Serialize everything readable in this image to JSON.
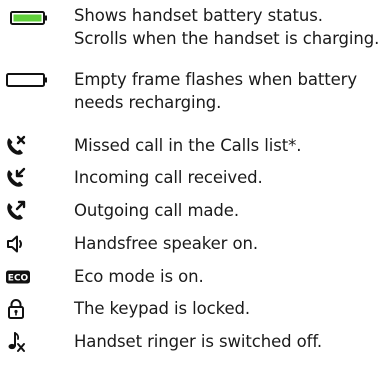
{
  "legend": {
    "colors": {
      "battery_fill": "#5fcf3a",
      "icon_dark": "#111111",
      "text": "#1a1a1a"
    },
    "items": [
      {
        "icon": "battery-charging-icon",
        "lines": [
          "Shows handset battery status.",
          "Scrolls when the handset is charging."
        ]
      },
      {
        "icon": "battery-empty-icon",
        "lines": [
          "Empty frame flashes when battery",
          "needs recharging."
        ]
      },
      {
        "icon": "missed-call-icon",
        "lines": [
          "Missed call in the Calls list*."
        ]
      },
      {
        "icon": "incoming-call-icon",
        "lines": [
          "Incoming call received."
        ]
      },
      {
        "icon": "outgoing-call-icon",
        "lines": [
          "Outgoing call made."
        ]
      },
      {
        "icon": "speaker-icon",
        "lines": [
          "Handsfree speaker on."
        ]
      },
      {
        "icon": "eco-mode-icon",
        "badge": "ECO",
        "lines": [
          "Eco mode is on."
        ]
      },
      {
        "icon": "keypad-lock-icon",
        "lines": [
          "The keypad is locked."
        ]
      },
      {
        "icon": "ringer-off-icon",
        "lines": [
          "Handset ringer is switched off."
        ]
      }
    ]
  }
}
